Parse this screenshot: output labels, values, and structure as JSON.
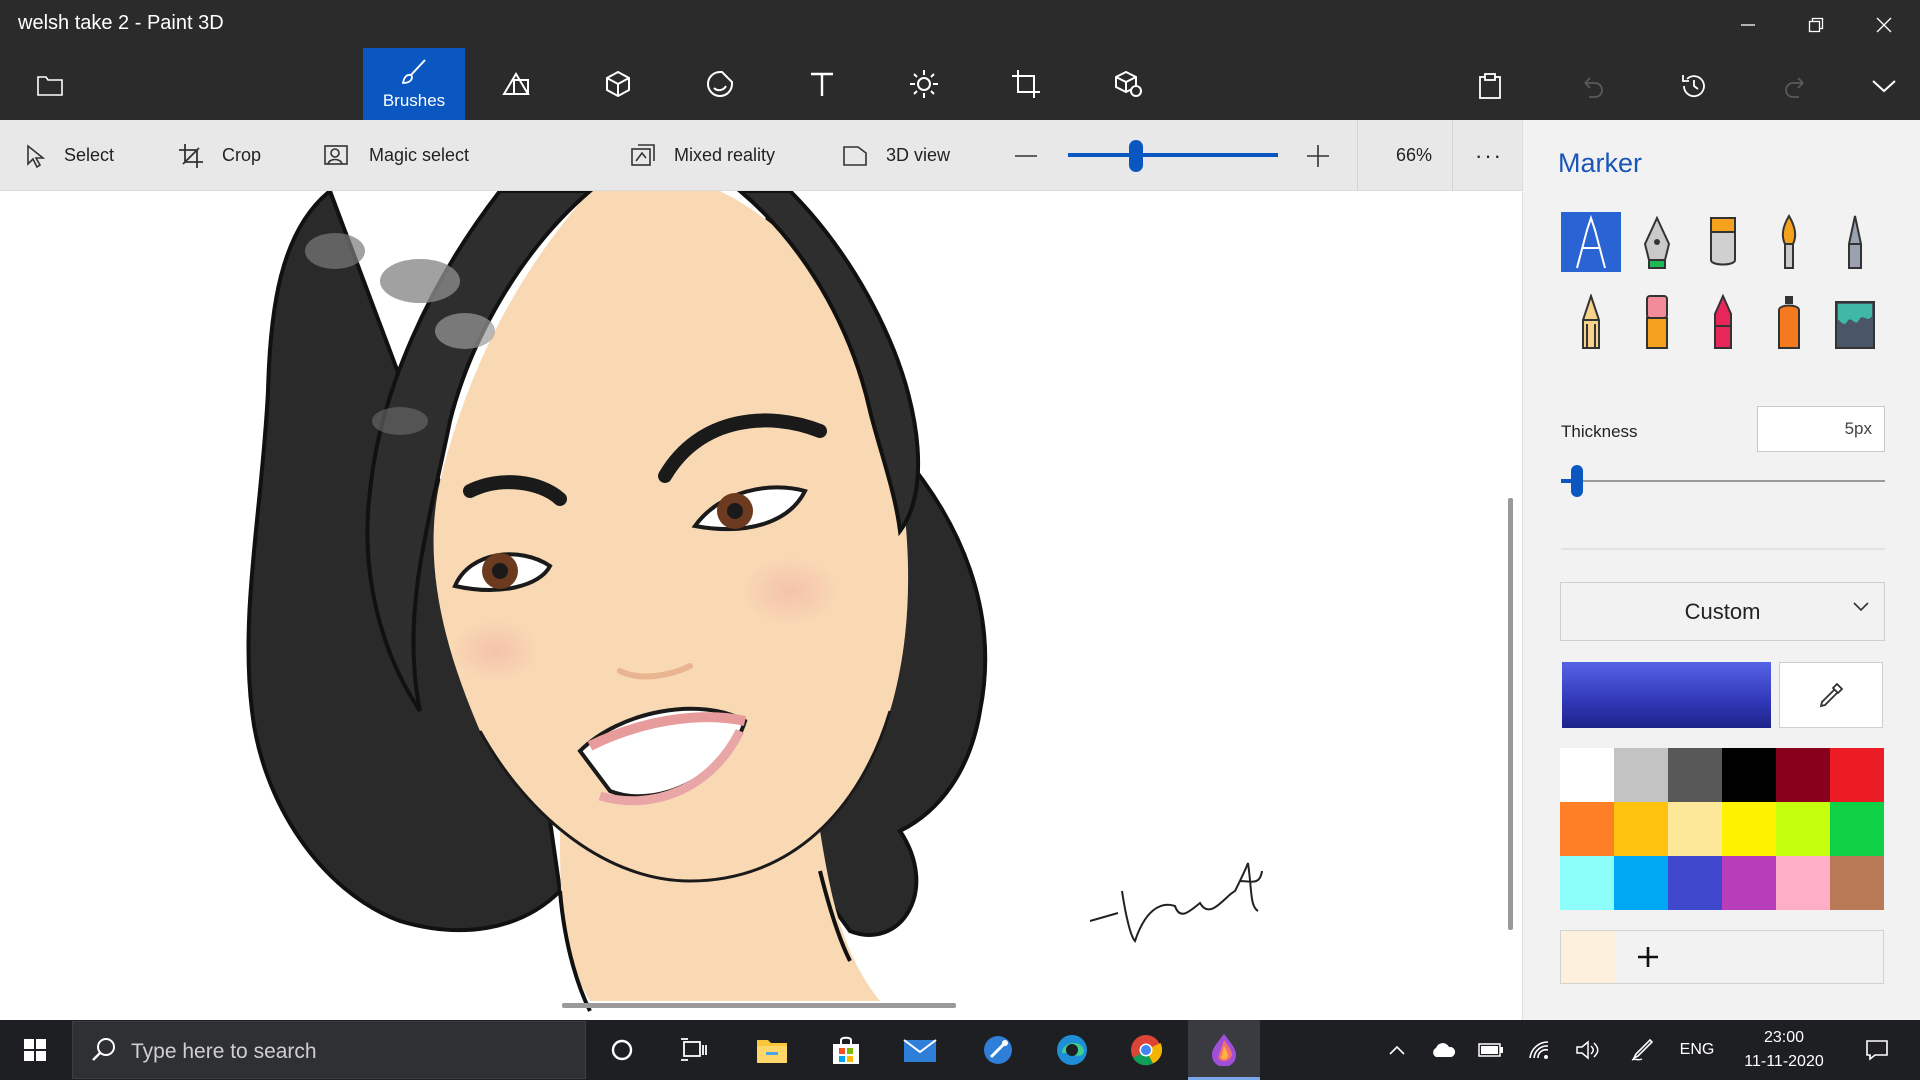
{
  "window": {
    "title": "welsh take 2 - Paint 3D"
  },
  "toolbar": {
    "tools": [
      {
        "name": "brushes",
        "label": "Brushes",
        "icon": "brush-icon",
        "active": true
      },
      {
        "name": "2d-shapes",
        "icon": "2d-shapes-icon"
      },
      {
        "name": "3d-shapes",
        "icon": "3d-cube-icon"
      },
      {
        "name": "stickers",
        "icon": "stickers-icon"
      },
      {
        "name": "text",
        "icon": "text-icon"
      },
      {
        "name": "effects",
        "icon": "effects-sun-icon"
      },
      {
        "name": "canvas",
        "icon": "canvas-icon"
      },
      {
        "name": "3d-library",
        "icon": "3d-library-icon"
      }
    ]
  },
  "subbar": {
    "select": "Select",
    "crop": "Crop",
    "magic_select": "Magic select",
    "mixed_reality": "Mixed reality",
    "view_3d": "3D view",
    "zoom": "66%",
    "zoom_value": 66,
    "more": "···"
  },
  "panel": {
    "title": "Marker",
    "brushes": [
      {
        "name": "marker",
        "icon": "marker-icon",
        "active": true
      },
      {
        "name": "calligraphy-pen",
        "icon": "calligraphy-pen-icon"
      },
      {
        "name": "oil-brush",
        "icon": "oil-brush-icon"
      },
      {
        "name": "watercolor",
        "icon": "watercolor-icon"
      },
      {
        "name": "pixel-pen",
        "icon": "pixel-pen-icon"
      },
      {
        "name": "pencil",
        "icon": "pencil-icon"
      },
      {
        "name": "eraser",
        "icon": "eraser-icon"
      },
      {
        "name": "crayon",
        "icon": "crayon-icon"
      },
      {
        "name": "spray-can",
        "icon": "spray-can-icon"
      },
      {
        "name": "fill",
        "icon": "fill-bucket-icon"
      }
    ],
    "thickness_label": "Thickness",
    "thickness_value": "5px",
    "finish_label": "Custom",
    "current_color": "#3a42c8",
    "palette": [
      "#ffffff",
      "#c3c3c3",
      "#585858",
      "#000000",
      "#88001b",
      "#ec1c24",
      "#ff7f27",
      "#ffc20e",
      "#fde89a",
      "#fff200",
      "#c4ff0e",
      "#0ed145",
      "#8cfffb",
      "#00a8f3",
      "#3f48cc",
      "#b83dba",
      "#ffaec8",
      "#b97a56"
    ],
    "custom_color": "#fdf1de",
    "add_color": "+"
  },
  "taskbar": {
    "search_placeholder": "Type here to search",
    "language": "ENG",
    "time": "23:00",
    "date": "11-11-2020"
  }
}
